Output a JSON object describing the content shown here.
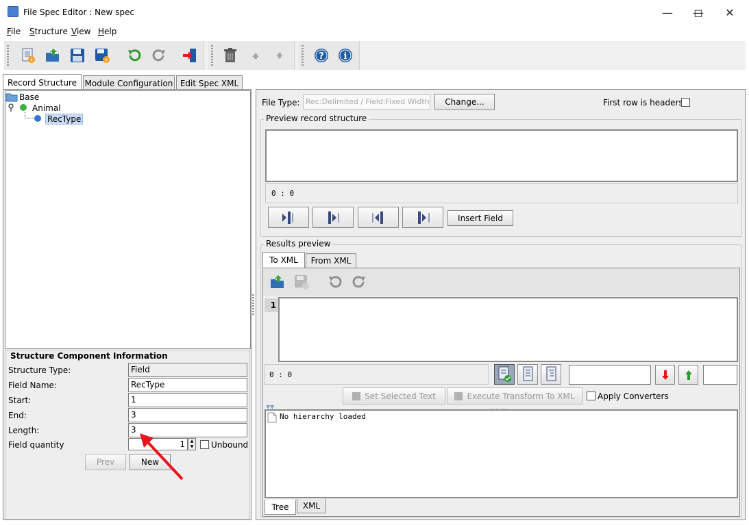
{
  "window": {
    "title": "File Spec Editor : New spec"
  },
  "menu": [
    {
      "label": "File",
      "key": "F",
      "rest": "ile"
    },
    {
      "label": "Structure",
      "key": "S",
      "rest": "tructure"
    },
    {
      "label": "View",
      "key": "V",
      "rest": "iew"
    },
    {
      "label": "Help",
      "key": "H",
      "rest": "elp"
    }
  ],
  "toolbar": [
    "new-file-icon",
    "open-file-icon",
    "save-icon",
    "save-as-icon",
    "undo-icon",
    "redo-icon",
    "exit-icon",
    "delete-icon",
    "move-up-icon",
    "move-down-icon",
    "help-icon",
    "info-icon"
  ],
  "left_tabs": [
    "Record Structure",
    "Module Configuration",
    "Edit Spec XML"
  ],
  "tree": {
    "root": "Base",
    "child": "Animal",
    "grandchild": "RecType"
  },
  "sci": {
    "title": "Structure Component Information",
    "structure_type_label": "Structure Type:",
    "structure_type": "Field",
    "field_name_label": "Field Name:",
    "field_name": "RecType",
    "start_label": "Start:",
    "start": "1",
    "end_label": "End:",
    "end": "3",
    "length_label": "Length:",
    "length": "3",
    "quantity_label": "Field quantity",
    "quantity": "1",
    "unbound_label": "Unbound",
    "prev": "Prev",
    "new": "New"
  },
  "right": {
    "file_type_label": "File Type:",
    "file_type_placeholder": "Rec:Delimited / Field:Fixed Width",
    "change": "Change...",
    "first_row_headers": "First row is headers",
    "preview_title": "Preview record structure",
    "preview_pos": "0 : 0",
    "insert_field": "Insert Field",
    "results_title": "Results preview",
    "result_tabs": [
      "To XML",
      "From XML"
    ],
    "line_number": "1",
    "editor_pos": "0 : 0",
    "set_selected": "Set Selected Text",
    "execute": "Execute Transform To XML",
    "apply_converters": "Apply Converters",
    "no_hierarchy": "No hierarchy loaded",
    "bottom_tabs": [
      "Tree",
      "XML"
    ]
  },
  "colors": {
    "arrow": "#e8141b",
    "selection": "#c8dcf5",
    "green": "#2a9a2a"
  }
}
